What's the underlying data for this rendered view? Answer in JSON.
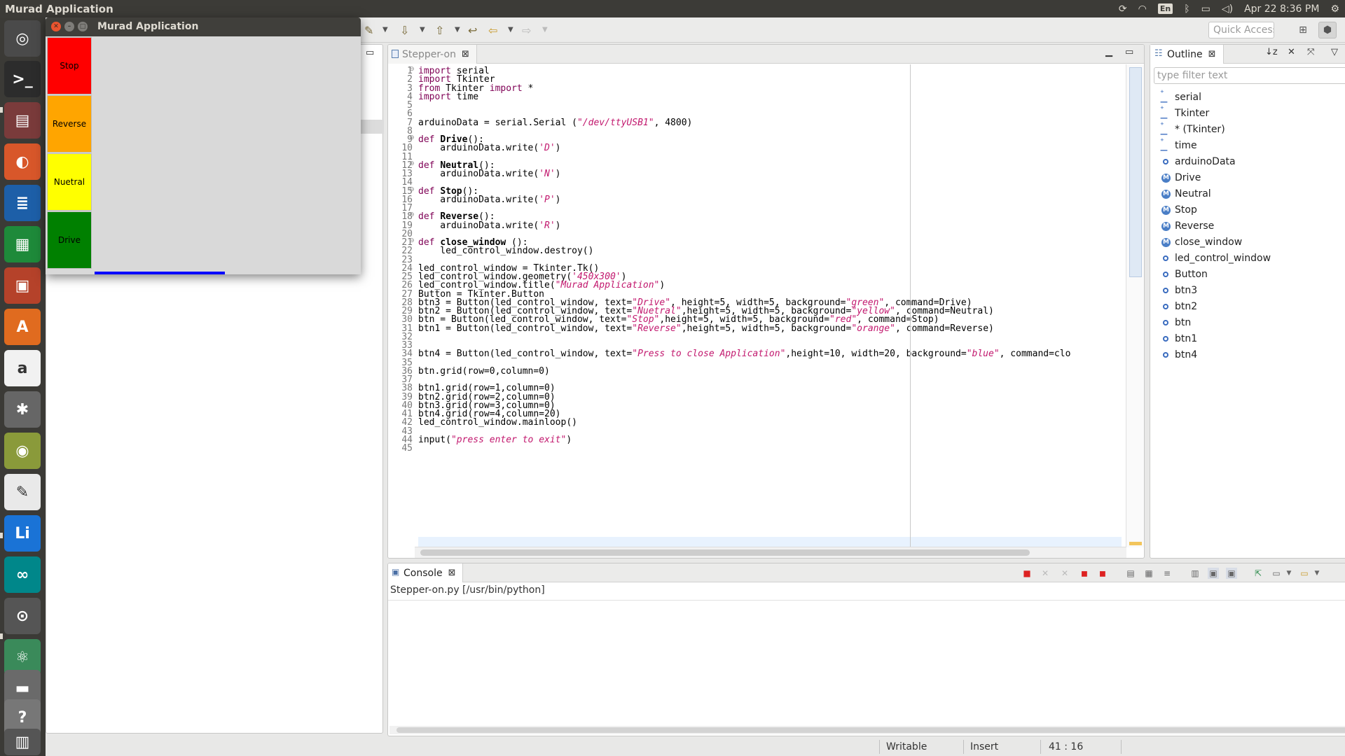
{
  "top_panel": {
    "app_title": "Murad Application",
    "language": "En",
    "datetime": "Apr 22  8:36 PM"
  },
  "launcher": {
    "items": [
      {
        "icon": "ubuntu-dash-icon",
        "color": "#4a4a4a"
      },
      {
        "icon": "terminal-icon",
        "color": "#2c2c2c"
      },
      {
        "icon": "files-icon",
        "color": "#7a3b3b"
      },
      {
        "icon": "firefox-icon",
        "color": "#d8572a"
      },
      {
        "icon": "writer-icon",
        "color": "#1d5fa8"
      },
      {
        "icon": "calc-icon",
        "color": "#1e8a3a"
      },
      {
        "icon": "impress-icon",
        "color": "#b5422a"
      },
      {
        "icon": "software-center-icon",
        "color": "#e06b1f"
      },
      {
        "icon": "amazon-icon",
        "color": "#f1f1f1"
      },
      {
        "icon": "system-settings-icon",
        "color": "#666666"
      },
      {
        "icon": "image-viewer-icon",
        "color": "#8a9a3a"
      },
      {
        "icon": "text-editor-icon",
        "color": "#e9e9e9"
      },
      {
        "icon": "liclipse-icon",
        "color": "#1a73d6"
      },
      {
        "icon": "arduino-icon",
        "color": "#00878a"
      },
      {
        "icon": "software-updater-icon",
        "color": "#555555"
      },
      {
        "icon": "atom-icon",
        "color": "#3a8a5a"
      },
      {
        "icon": "drive-icon",
        "color": "#6a6a6a"
      },
      {
        "icon": "help-icon",
        "color": "#777777"
      },
      {
        "icon": "trash-icon",
        "color": "#555555"
      }
    ]
  },
  "eclipse": {
    "quick_access_placeholder": "Quick Access",
    "editor": {
      "tab_label": "Stepper-on",
      "line_numbers": [
        "1",
        "2",
        "3",
        "4",
        "5",
        "6",
        "7",
        "8",
        "9",
        "10",
        "11",
        "12",
        "13",
        "14",
        "15",
        "16",
        "17",
        "18",
        "19",
        "20",
        "21",
        "22",
        "23",
        "24",
        "25",
        "26",
        "27",
        "28",
        "29",
        "30",
        "31",
        "32",
        "33",
        "34",
        "35",
        "36",
        "37",
        "38",
        "39",
        "40",
        "41",
        "42",
        "43",
        "44",
        "45"
      ],
      "code": [
        [
          [
            "kw",
            "import"
          ],
          [
            "plain",
            " serial"
          ]
        ],
        [
          [
            "kw",
            "import"
          ],
          [
            "plain",
            " Tkinter"
          ]
        ],
        [
          [
            "kw",
            "from"
          ],
          [
            "plain",
            " Tkinter "
          ],
          [
            "kw",
            "import"
          ],
          [
            "plain",
            " *"
          ]
        ],
        [
          [
            "kw",
            "import"
          ],
          [
            "plain",
            " time"
          ]
        ],
        [],
        [],
        [
          [
            "plain",
            "arduinoData = serial.Serial ("
          ],
          [
            "str",
            "\"/dev/ttyUSB1\""
          ],
          [
            "plain",
            ", 4800)"
          ]
        ],
        [],
        [
          [
            "kw",
            "def"
          ],
          [
            "plain",
            " "
          ],
          [
            "fn",
            "Drive"
          ],
          [
            "plain",
            "():"
          ]
        ],
        [
          [
            "plain",
            "    arduinoData.write("
          ],
          [
            "str",
            "'D'"
          ],
          [
            "plain",
            ")"
          ]
        ],
        [],
        [
          [
            "kw",
            "def"
          ],
          [
            "plain",
            " "
          ],
          [
            "fn",
            "Neutral"
          ],
          [
            "plain",
            "():"
          ]
        ],
        [
          [
            "plain",
            "    arduinoData.write("
          ],
          [
            "str",
            "'N'"
          ],
          [
            "plain",
            ")"
          ]
        ],
        [],
        [
          [
            "kw",
            "def"
          ],
          [
            "plain",
            " "
          ],
          [
            "fn",
            "Stop"
          ],
          [
            "plain",
            "():"
          ]
        ],
        [
          [
            "plain",
            "    arduinoData.write("
          ],
          [
            "str",
            "'P'"
          ],
          [
            "plain",
            ")"
          ]
        ],
        [],
        [
          [
            "kw",
            "def"
          ],
          [
            "plain",
            " "
          ],
          [
            "fn",
            "Reverse"
          ],
          [
            "plain",
            "():"
          ]
        ],
        [
          [
            "plain",
            "    arduinoData.write("
          ],
          [
            "str",
            "'R'"
          ],
          [
            "plain",
            ")"
          ]
        ],
        [],
        [
          [
            "kw",
            "def"
          ],
          [
            "plain",
            " "
          ],
          [
            "fn",
            "close_window"
          ],
          [
            "plain",
            " ():"
          ]
        ],
        [
          [
            "plain",
            "    led_control_window.destroy()"
          ]
        ],
        [],
        [
          [
            "plain",
            "led_control_window = Tkinter.Tk()"
          ]
        ],
        [
          [
            "plain",
            "led_control_window.geometry("
          ],
          [
            "str",
            "'450x300'"
          ],
          [
            "plain",
            ")"
          ]
        ],
        [
          [
            "plain",
            "led_control_window.title("
          ],
          [
            "str",
            "\"Murad Application\""
          ],
          [
            "plain",
            ")"
          ]
        ],
        [
          [
            "plain",
            "Button = Tkinter.Button"
          ]
        ],
        [
          [
            "plain",
            "btn3 = Button(led_control_window, text="
          ],
          [
            "str",
            "\"Drive\""
          ],
          [
            "plain",
            ", height=5, width=5, background="
          ],
          [
            "str",
            "\"green\""
          ],
          [
            "plain",
            ", command=Drive)"
          ]
        ],
        [
          [
            "plain",
            "btn2 = Button(led_control_window, text="
          ],
          [
            "str",
            "\"Nuetral\""
          ],
          [
            "plain",
            ",height=5, width=5, background="
          ],
          [
            "str",
            "\"yellow\""
          ],
          [
            "plain",
            ", command=Neutral)"
          ]
        ],
        [
          [
            "plain",
            "btn = Button(led_control_window, text="
          ],
          [
            "str",
            "\"Stop\""
          ],
          [
            "plain",
            ",height=5, width=5, background="
          ],
          [
            "str",
            "\"red\""
          ],
          [
            "plain",
            ", command=Stop)"
          ]
        ],
        [
          [
            "plain",
            "btn1 = Button(led_control_window, text="
          ],
          [
            "str",
            "\"Reverse\""
          ],
          [
            "plain",
            ",height=5, width=5, background="
          ],
          [
            "str",
            "\"orange\""
          ],
          [
            "plain",
            ", command=Reverse)"
          ]
        ],
        [],
        [],
        [
          [
            "plain",
            "btn4 = Button(led_control_window, text="
          ],
          [
            "str",
            "\"Press to close Application\""
          ],
          [
            "plain",
            ",height=10, width=20, background="
          ],
          [
            "str",
            "\"blue\""
          ],
          [
            "plain",
            ", command=clo"
          ]
        ],
        [],
        [
          [
            "plain",
            "btn.grid(row=0,column=0)"
          ]
        ],
        [],
        [
          [
            "plain",
            "btn1.grid(row=1,column=0)"
          ]
        ],
        [
          [
            "plain",
            "btn2.grid(row=2,column=0)"
          ]
        ],
        [
          [
            "plain",
            "btn3.grid(row=3,column=0)"
          ]
        ],
        [
          [
            "plain",
            "btn4.grid(row=4,column=20)"
          ]
        ],
        [
          [
            "plain",
            "led_control_window.mainloop()"
          ]
        ],
        [],
        [
          [
            "plain",
            "input("
          ],
          [
            "str",
            "\"press enter to exit\""
          ],
          [
            "plain",
            ")"
          ]
        ],
        []
      ]
    },
    "outline": {
      "tab_label": "Outline",
      "filter_placeholder": "type filter text",
      "items": [
        {
          "label": "serial",
          "kind": "import"
        },
        {
          "label": "Tkinter",
          "kind": "import"
        },
        {
          "label": "* (Tkinter)",
          "kind": "import"
        },
        {
          "label": "time",
          "kind": "import"
        },
        {
          "label": "arduinoData",
          "kind": "var"
        },
        {
          "label": "Drive",
          "kind": "function"
        },
        {
          "label": "Neutral",
          "kind": "function"
        },
        {
          "label": "Stop",
          "kind": "function"
        },
        {
          "label": "Reverse",
          "kind": "function"
        },
        {
          "label": "close_window",
          "kind": "function"
        },
        {
          "label": "led_control_window",
          "kind": "var"
        },
        {
          "label": "Button",
          "kind": "var"
        },
        {
          "label": "btn3",
          "kind": "var"
        },
        {
          "label": "btn2",
          "kind": "var"
        },
        {
          "label": "btn",
          "kind": "var"
        },
        {
          "label": "btn1",
          "kind": "var"
        },
        {
          "label": "btn4",
          "kind": "var"
        }
      ]
    },
    "console": {
      "tab_label": "Console",
      "process_label": "Stepper-on.py [/usr/bin/python]"
    },
    "status": {
      "writable": "Writable",
      "insert_mode": "Insert",
      "position": "41 : 16"
    }
  },
  "tk_window": {
    "title": "Murad Application",
    "buttons": [
      {
        "label": "Stop",
        "color": "#ff0000"
      },
      {
        "label": "Reverse",
        "color": "#ffa500"
      },
      {
        "label": "Nuetral",
        "color": "#ffff00"
      },
      {
        "label": "Drive",
        "color": "#008000"
      }
    ],
    "close_button_color": "#0000ff"
  }
}
